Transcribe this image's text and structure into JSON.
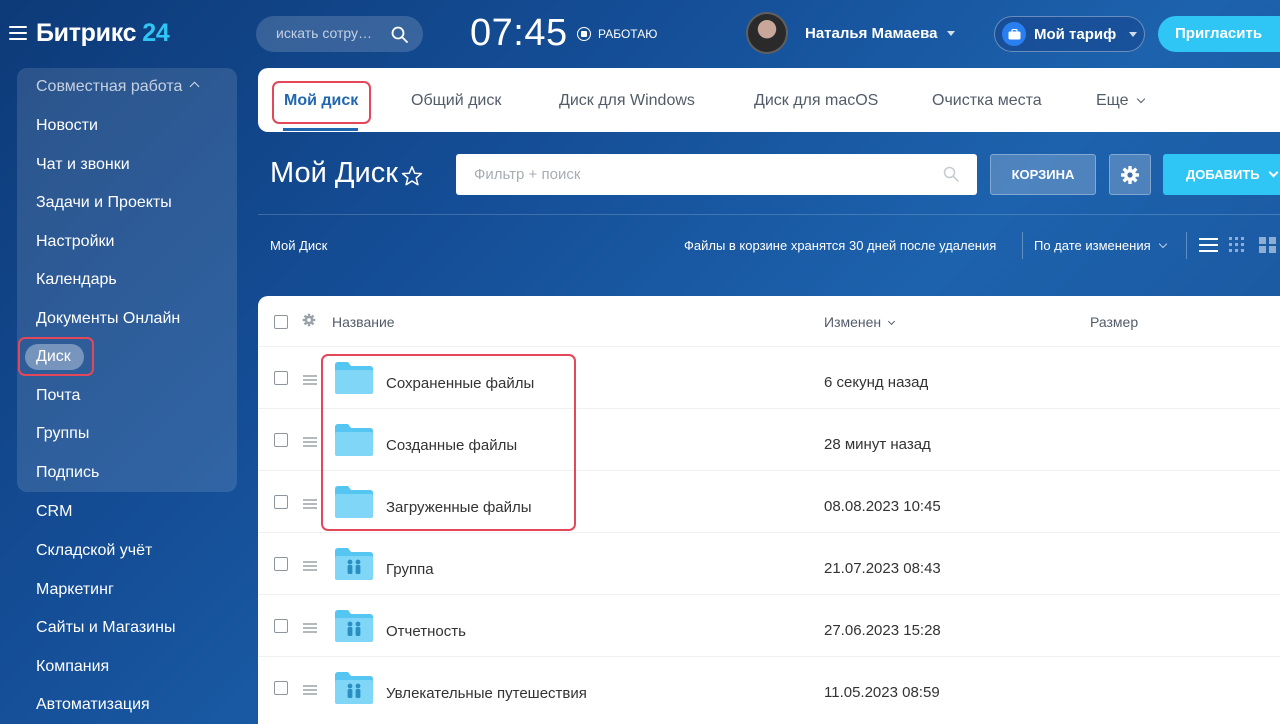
{
  "header": {
    "logo_text": "Битрикс",
    "logo_num": "24",
    "search_placeholder": "искать сотру…",
    "clock": "07:45",
    "work_status": "РАБОТАЮ",
    "user_name": "Наталья Мамаева",
    "tariff_label": "Мой тариф",
    "invite_label": "Пригласить"
  },
  "sidebar": {
    "group_title": "Совместная работа",
    "group_items": [
      "Новости",
      "Чат и звонки",
      "Задачи и Проекты",
      "Настройки",
      "Календарь",
      "Документы Онлайн",
      "Диск",
      "Почта",
      "Группы",
      "Подпись"
    ],
    "items": [
      "CRM",
      "Складской учёт",
      "Маркетинг",
      "Сайты и Магазины",
      "Компания",
      "Автоматизация"
    ],
    "active_item": "Диск"
  },
  "tabs": [
    {
      "label": "Мой диск",
      "active": true
    },
    {
      "label": "Общий диск",
      "active": false
    },
    {
      "label": "Диск для Windows",
      "active": false
    },
    {
      "label": "Диск для macOS",
      "active": false
    },
    {
      "label": "Очистка места",
      "active": false
    },
    {
      "label": "Еще",
      "active": false
    }
  ],
  "page": {
    "title": "Мой Диск",
    "filter_placeholder": "Фильтр + поиск",
    "trash_button": "КОРЗИНА",
    "add_button": "ДОБАВИТЬ",
    "breadcrumb": "Мой Диск",
    "trash_note": "Файлы в корзине хранятся 30 дней после удаления",
    "sort_label": "По дате изменения"
  },
  "table": {
    "columns": {
      "name": "Название",
      "modified": "Изменен",
      "size": "Размер"
    },
    "rows": [
      {
        "name": "Сохраненные файлы",
        "modified": "6 секунд назад",
        "icon": "folder-icon"
      },
      {
        "name": "Созданные файлы",
        "modified": "28 минут назад",
        "icon": "folder-icon"
      },
      {
        "name": "Загруженные файлы",
        "modified": "08.08.2023 10:45",
        "icon": "folder-icon"
      },
      {
        "name": "Группа",
        "modified": "21.07.2023 08:43",
        "icon": "group-folder-icon"
      },
      {
        "name": "Отчетность",
        "modified": "27.06.2023 15:28",
        "icon": "group-folder-icon"
      },
      {
        "name": "Увлекательные путешествия",
        "modified": "11.05.2023 08:59",
        "icon": "group-folder-icon"
      }
    ]
  },
  "colors": {
    "accent": "#2fc6f6",
    "link": "#2067b0",
    "highlight": "#e5475a",
    "folder": "#7fd6f7"
  }
}
